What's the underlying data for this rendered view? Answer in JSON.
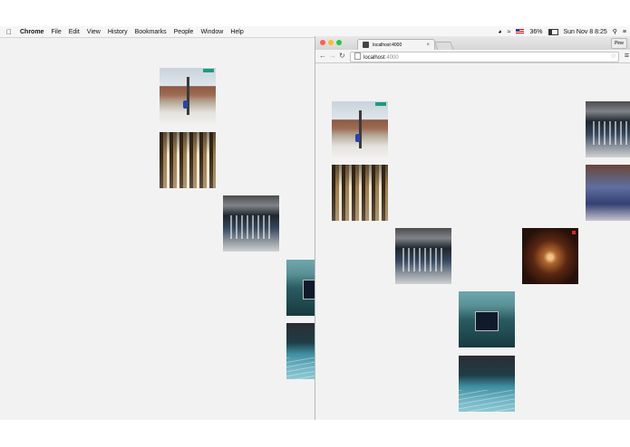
{
  "menubar": {
    "app_name": "Chrome",
    "items": [
      "File",
      "Edit",
      "View",
      "History",
      "Bookmarks",
      "People",
      "Window",
      "Help"
    ],
    "battery": "36%",
    "clock": "Sun Nov 8  8:25"
  },
  "browser": {
    "tab_title": "localhost:4000",
    "tab_close": "×",
    "profile_name": "Pine",
    "address_host": "localhost",
    "address_port": ":4000"
  },
  "desktop_photos": [
    {
      "subject": "street"
    },
    {
      "subject": "cafeteria"
    },
    {
      "subject": "hall"
    },
    {
      "subject": "stage"
    },
    {
      "subject": "pool"
    }
  ],
  "page_photos": [
    {
      "subject": "street"
    },
    {
      "subject": "cafeteria"
    },
    {
      "subject": "hall"
    },
    {
      "subject": "stage"
    },
    {
      "subject": "pool"
    },
    {
      "subject": "tunnel"
    },
    {
      "subject": "hall"
    },
    {
      "subject": "crowd"
    }
  ],
  "icons": {
    "apple": "apple-icon",
    "wifi": "wifi-icon",
    "search": "search-icon",
    "back": "back-arrow-icon",
    "forward": "forward-arrow-icon",
    "reload": "reload-icon",
    "star": "star-icon",
    "menu": "hamburger-menu-icon"
  },
  "colors": {
    "traffic_close": "#fc5f57",
    "traffic_min": "#fdbc2e",
    "traffic_max": "#28c840",
    "canvas": "#f2f2f2"
  }
}
